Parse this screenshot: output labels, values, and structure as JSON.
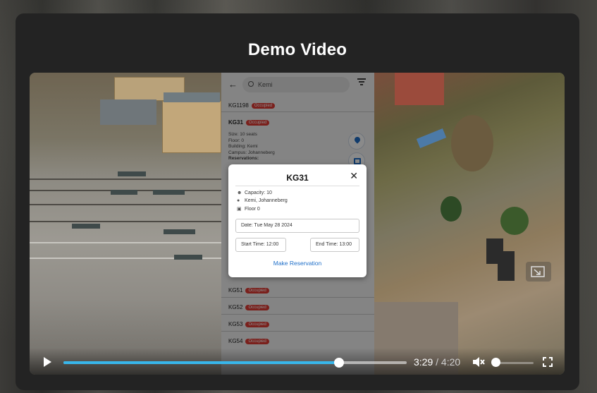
{
  "modal": {
    "title": "Demo Video"
  },
  "phone": {
    "search_placeholder": "Kemi",
    "rooms": [
      {
        "name": "KG1198",
        "status": "Occupied"
      },
      {
        "name": "KG31",
        "status": "Occupied"
      },
      {
        "name": "KG51",
        "status": "Occupied"
      },
      {
        "name": "KG52",
        "status": "Occupied"
      },
      {
        "name": "KG53",
        "status": "Occupied"
      },
      {
        "name": "KG54",
        "status": "Occupied"
      }
    ],
    "detail": {
      "size": "Size: 10 seats",
      "floor": "Floor: 0",
      "building": "Building: Kemi",
      "campus": "Campus: Johanneberg",
      "reservations": "Reservations:"
    }
  },
  "dialog": {
    "title": "KG31",
    "capacity": "Capacity: 10",
    "location": "Kemi, Johanneberg",
    "floor": "Floor 0",
    "date": "Date: Tue May 28 2024",
    "start_time": "Start Time: 12:00",
    "end_time": "End Time: 13:00",
    "action": "Make Reservation"
  },
  "player": {
    "current_time": "3:29",
    "separator": "/",
    "duration": "4:20",
    "progress": 0.803,
    "volume": 0.0
  },
  "icons": [
    "play-icon",
    "mute-icon",
    "fullscreen-icon",
    "close-icon",
    "search-icon",
    "filter-icon",
    "back-arrow-icon",
    "location-pin-icon",
    "calendar-icon",
    "people-icon",
    "pip-icon"
  ],
  "colors": {
    "accent": "#38b6ea",
    "occupied": "#e23b34",
    "link": "#1f6fc9"
  }
}
